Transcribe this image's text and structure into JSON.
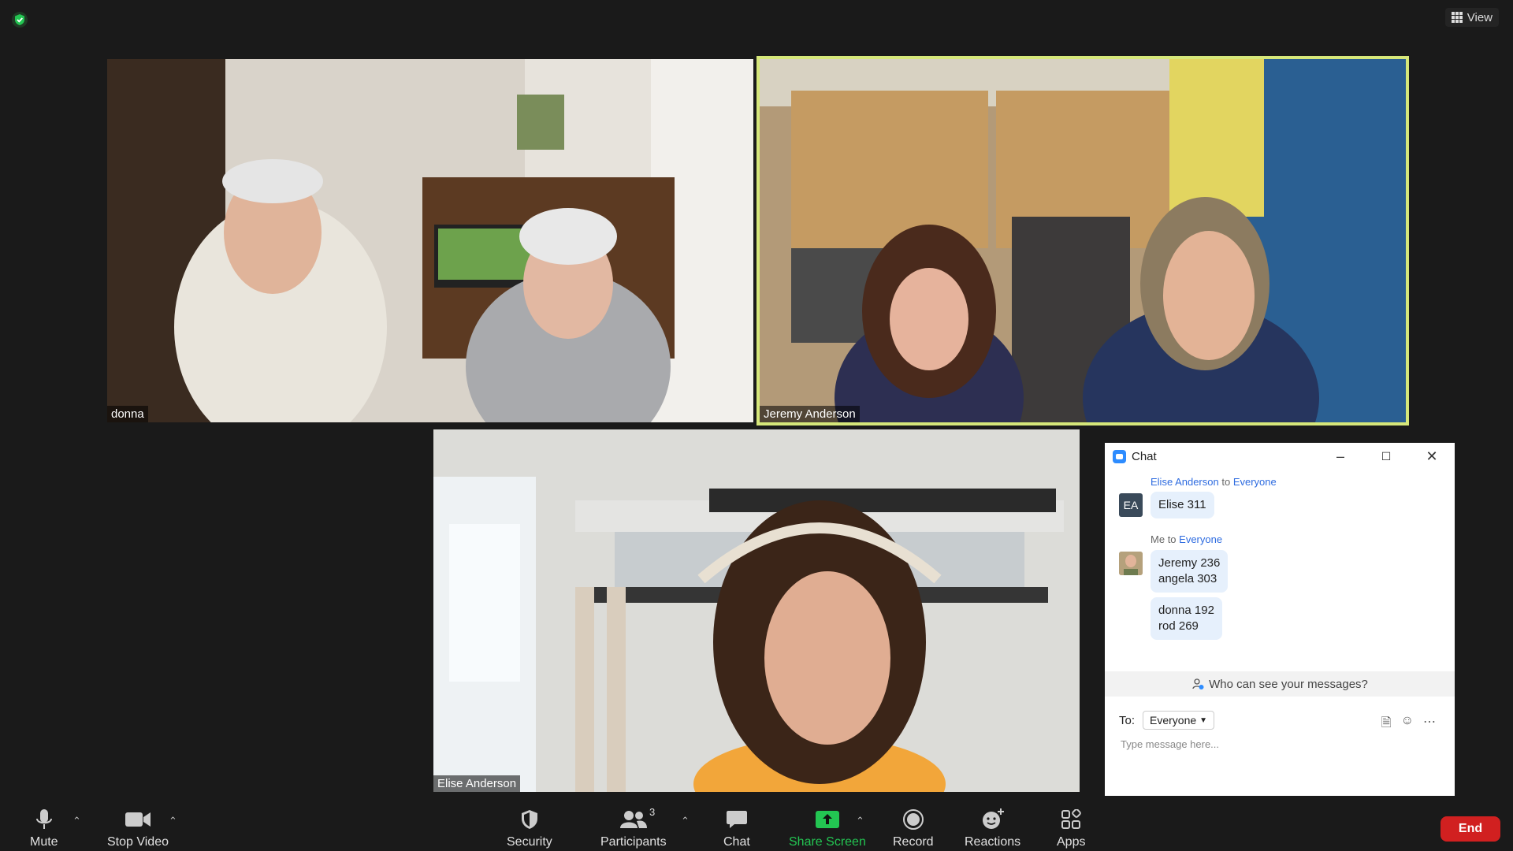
{
  "top": {
    "view_label": "View"
  },
  "tiles": {
    "donna": {
      "name": "donna"
    },
    "jeremy": {
      "name": "Jeremy Anderson"
    },
    "elise": {
      "name": "Elise Anderson"
    }
  },
  "chat": {
    "title": "Chat",
    "messages": [
      {
        "sender": "Elise Anderson",
        "to_word": "to",
        "recipient": "Everyone",
        "avatar": "EA",
        "text": "Elise 311"
      },
      {
        "sender": "Me",
        "to_word": "to",
        "recipient": "Everyone",
        "text1": "Jeremy 236\nangela 303",
        "text2": "donna 192\nrod 269"
      }
    ],
    "who_can_see": "Who can see your messages?",
    "to_label": "To:",
    "to_value": "Everyone",
    "placeholder": "Type message here..."
  },
  "toolbar": {
    "mute": "Mute",
    "stop_video": "Stop Video",
    "security": "Security",
    "participants": "Participants",
    "participants_count": "3",
    "chat": "Chat",
    "share_screen": "Share Screen",
    "record": "Record",
    "reactions": "Reactions",
    "apps": "Apps",
    "end": "End"
  },
  "colors": {
    "accent_green": "#23c552",
    "active_speaker": "#d6e77a",
    "end_red": "#d12020",
    "link_blue": "#2d6be0"
  }
}
